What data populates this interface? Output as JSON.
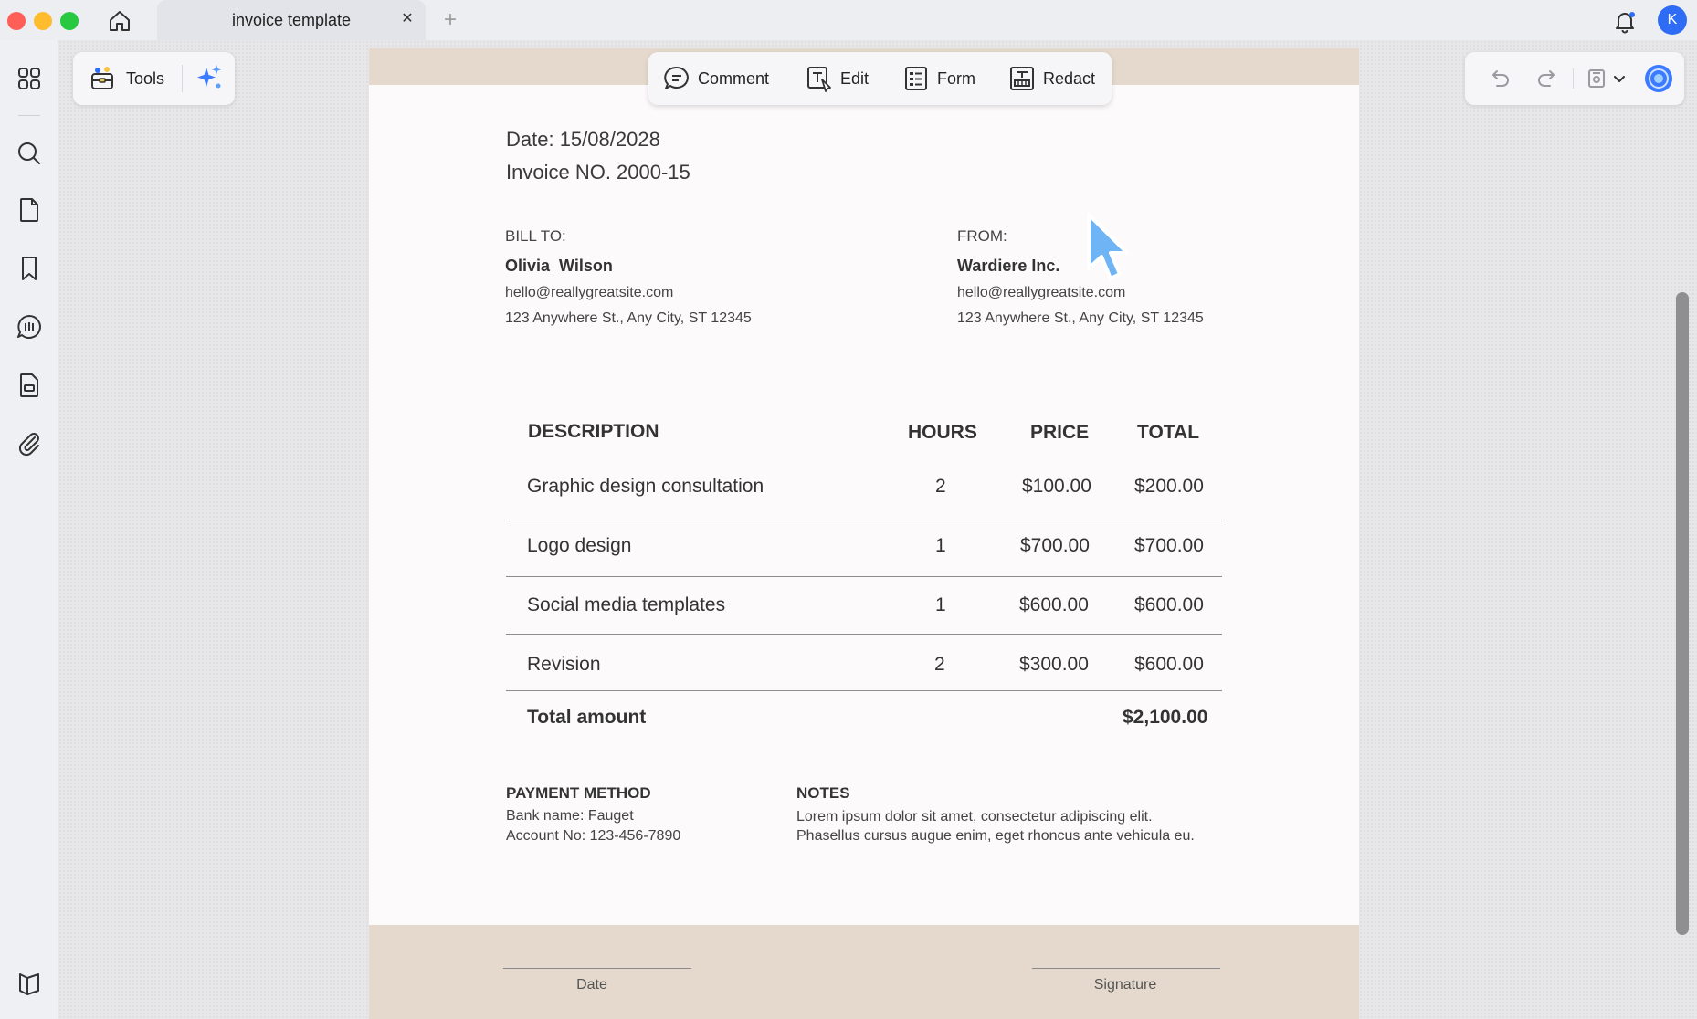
{
  "window": {
    "tab_title": "invoice template",
    "tab_close": "✕",
    "tab_add": "+",
    "avatar_initial": "K"
  },
  "toolbar": {
    "tools_label": "Tools",
    "comment_label": "Comment",
    "edit_label": "Edit",
    "form_label": "Form",
    "redact_label": "Redact"
  },
  "sidebar": {
    "items": [
      "apps-icon",
      "search-icon",
      "pages-icon",
      "bookmark-icon",
      "comments-icon",
      "form-fields-icon",
      "attachment-icon"
    ],
    "bottom": "reader-mode-icon"
  },
  "invoice": {
    "date": "Date: 15/08/2028",
    "number": "Invoice NO. 2000-15",
    "bill_to": {
      "label": "BILL TO:",
      "name": "Olivia  Wilson",
      "email": "hello@reallygreatsite.com",
      "address": "123 Anywhere St., Any City, ST 12345"
    },
    "from": {
      "label": "FROM:",
      "name": "Wardiere Inc.",
      "email": "hello@reallygreatsite.com",
      "address": "123 Anywhere St., Any City, ST 12345"
    },
    "table": {
      "headers": {
        "description": "DESCRIPTION",
        "hours": "HOURS",
        "price": "PRICE",
        "total": "TOTAL"
      },
      "rows": [
        {
          "description": "Graphic design consultation",
          "hours": "2",
          "price": "$100.00",
          "total": "$200.00"
        },
        {
          "description": "Logo design",
          "hours": "1",
          "price": "$700.00",
          "total": "$700.00"
        },
        {
          "description": "Social media templates",
          "hours": "1",
          "price": "$600.00",
          "total": "$600.00"
        },
        {
          "description": "Revision",
          "hours": "2",
          "price": "$300.00",
          "total": "$600.00"
        }
      ],
      "total_label": "Total amount",
      "total_value": "$2,100.00"
    },
    "payment": {
      "title": "PAYMENT METHOD",
      "bank": "Bank name: Fauget",
      "account": "Account No: 123-456-7890"
    },
    "notes": {
      "title": "NOTES",
      "line1": "Lorem ipsum dolor sit amet, consectetur adipiscing elit.",
      "line2": "Phasellus cursus augue enim, eget rhoncus ante vehicula eu."
    },
    "footer": {
      "date_label": "Date",
      "signature_label": "Signature"
    }
  },
  "colors": {
    "accent_blue": "#2f6cf5",
    "band_beige": "#e4d9cc"
  }
}
